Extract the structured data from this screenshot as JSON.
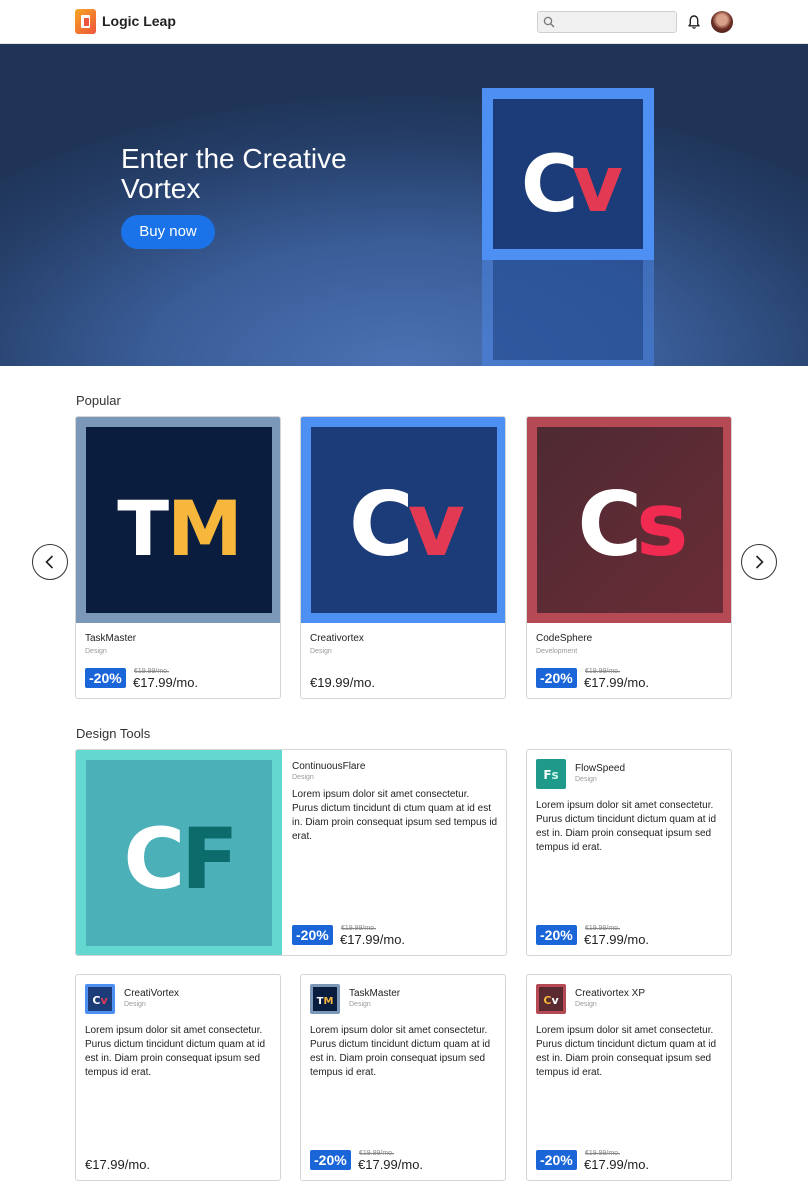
{
  "header": {
    "brand": "Logic Leap",
    "search_placeholder": "",
    "icons": [
      "search-icon",
      "bell-icon"
    ]
  },
  "hero": {
    "title": "Enter the Creative Vortex",
    "button": "Buy now",
    "logo_text": "Cv"
  },
  "popular": {
    "title": "Popular",
    "items": [
      {
        "name": "TaskMaster",
        "category": "Design",
        "logo": "TM",
        "discount": "-20%",
        "old_price": "€19.99/mo.",
        "price": "€17.99/mo."
      },
      {
        "name": "Creativortex",
        "category": "Design",
        "logo": "Cv",
        "price": "€19.99/mo."
      },
      {
        "name": "CodeSphere",
        "category": "Development",
        "logo": "Cs",
        "discount": "-20%",
        "old_price": "€19.99/mo.",
        "price": "€17.99/mo."
      }
    ]
  },
  "design_tools": {
    "title": "Design Tools",
    "featured": {
      "name": "ContinuousFlare",
      "category": "Design",
      "logo": "CF",
      "description": "Lorem ipsum dolor sit amet consectetur. Purus dictum tincidunt di ctum quam at id est in. Diam proin consequat ipsum sed tempus id erat.",
      "discount": "-20%",
      "old_price": "€19.99/mo.",
      "price": "€17.99/mo."
    },
    "items": [
      {
        "name": "FlowSpeed",
        "category": "Design",
        "logo": "Fs",
        "description": "Lorem ipsum dolor sit amet consectetur. Purus dictum tincidunt dictum quam at id est in. Diam proin consequat ipsum sed tempus id erat.",
        "discount": "-20%",
        "old_price": "€19.99/mo.",
        "price": "€17.99/mo."
      },
      {
        "name": "CreatiVortex",
        "category": "Design",
        "logo": "Cv",
        "description": "Lorem ipsum dolor sit amet consectetur. Purus dictum tincidunt dictum quam at id est in. Diam proin consequat ipsum sed tempus id erat.",
        "price": "€17.99/mo."
      },
      {
        "name": "TaskMaster",
        "category": "Design",
        "logo": "TM",
        "description": "Lorem ipsum dolor sit amet consectetur. Purus dictum tincidunt dictum quam at id est in. Diam proin consequat ipsum sed tempus id erat.",
        "discount": "-20%",
        "old_price": "€19.99/mo.",
        "price": "€17.99/mo."
      },
      {
        "name": "Creativortex XP",
        "category": "Design",
        "logo": "Cv",
        "description": "Lorem ipsum dolor sit amet consectetur. Purus dictum tincidunt dictum quam at id est in. Diam proin consequat ipsum sed tempus id erat.",
        "discount": "-20%",
        "old_price": "€19.99/mo.",
        "price": "€17.99/mo."
      }
    ]
  },
  "colors": {
    "accent": "#1a66d8",
    "hero_bg": "#2c4a80",
    "cv_frame": "#4e8ff4",
    "cv_fill": "#1b3c78",
    "tm_frame": "#7b98b8",
    "tm_fill": "#0b1d3f",
    "cs_frame": "#b54a55",
    "cs_fill": "#5a2a30",
    "cf_frame": "#63d8d0",
    "cf_fill": "#4cb0b8",
    "fs_fill": "#1f9a8a"
  }
}
